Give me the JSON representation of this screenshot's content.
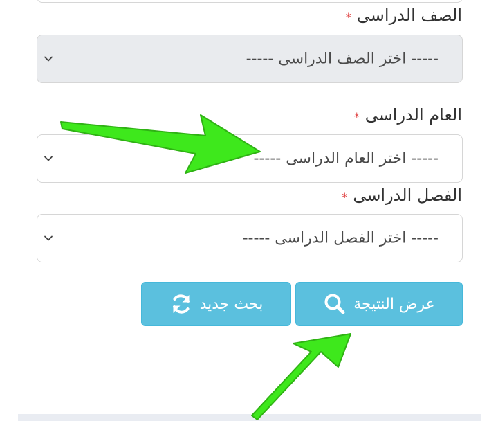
{
  "form": {
    "grade": {
      "label": "الصف الدراسى",
      "required_mark": "*",
      "placeholder": "-----  اختر الصف الدراسى  -----"
    },
    "year": {
      "label": "العام الدراسى",
      "required_mark": "*",
      "placeholder": "-----  اختر العام الدراسى  -----"
    },
    "term": {
      "label": "الفصل الدراسى",
      "required_mark": "*",
      "placeholder": "-----  اختر الفصل الدراسى  -----"
    }
  },
  "buttons": {
    "show_result": "عرض النتيجة",
    "new_search": "بحث جديد"
  },
  "icons": {
    "show_result": "search-icon",
    "new_search": "refresh-icon",
    "dropdown": "chevron-down-icon",
    "annotation": "green-arrow-icon"
  },
  "colors": {
    "button_bg": "#5bc0de",
    "required": "#e04343",
    "arrow": "#3ee81c"
  }
}
